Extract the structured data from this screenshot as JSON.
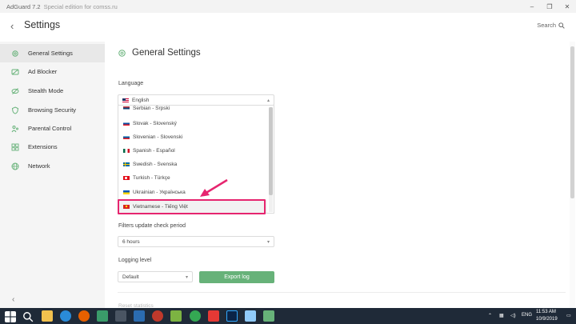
{
  "window": {
    "title": "AdGuard 7.2",
    "subtitle": "Special edition for comss.ru"
  },
  "header": {
    "back_icon": "chevron-left-icon",
    "title": "Settings",
    "search_label": "Search"
  },
  "sidebar": {
    "items": [
      {
        "label": "General Settings",
        "icon": "gear-icon",
        "active": true
      },
      {
        "label": "Ad Blocker",
        "icon": "ad-blocker-icon",
        "active": false
      },
      {
        "label": "Stealth Mode",
        "icon": "stealth-icon",
        "active": false
      },
      {
        "label": "Browsing Security",
        "icon": "shield-icon",
        "active": false
      },
      {
        "label": "Parental Control",
        "icon": "parental-icon",
        "active": false
      },
      {
        "label": "Extensions",
        "icon": "extensions-icon",
        "active": false
      },
      {
        "label": "Network",
        "icon": "globe-icon",
        "active": false
      }
    ]
  },
  "main": {
    "title": "General Settings",
    "language": {
      "label": "Language",
      "selected": "English",
      "options": [
        {
          "label": "Serbian - Srpski"
        },
        {
          "label": "Slovak - Slovenský"
        },
        {
          "label": "Slovenian - Slovenski"
        },
        {
          "label": "Spanish - Español"
        },
        {
          "label": "Swedish - Svenska"
        },
        {
          "label": "Turkish - Türkçe"
        },
        {
          "label": "Ukrainian - Українська"
        },
        {
          "label": "Vietnamese - Tiếng Việt"
        }
      ]
    },
    "filters_update": {
      "label": "Filters update check period",
      "value": "6 hours"
    },
    "logging": {
      "label": "Logging level",
      "value": "Default",
      "export_label": "Export log"
    },
    "faded_section": "Reset statistics"
  },
  "taskbar": {
    "lang": "ENG",
    "time": "11:53 AM",
    "date": "10/9/2019"
  },
  "colors": {
    "highlight": "#e6256f",
    "accent_green": "#67b279",
    "taskbar": "#1f2a38"
  }
}
